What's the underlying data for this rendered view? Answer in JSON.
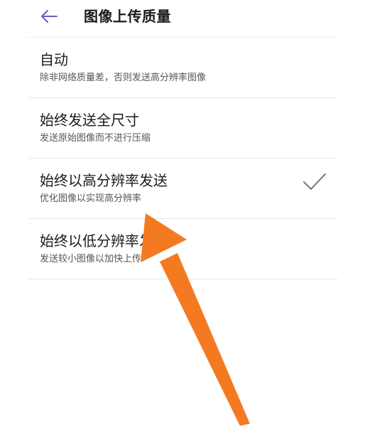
{
  "header": {
    "title": "图像上传质量",
    "back_icon": "arrow-left-icon"
  },
  "options": [
    {
      "title": "自动",
      "subtitle": "除非网络质量差，否则发送高分辨率图像",
      "selected": false
    },
    {
      "title": "始终发送全尺寸",
      "subtitle": "发送原始图像而不进行压缩",
      "selected": false
    },
    {
      "title": "始终以高分辨率发送",
      "subtitle": "优化图像以实现高分辨率",
      "selected": true
    },
    {
      "title": "始终以低分辨率发送",
      "subtitle": "发送较小图像以加快上传",
      "selected": false
    }
  ],
  "colors": {
    "accent": "#6b5fb5",
    "check": "#6a6a6a",
    "annotation_arrow": "#f47a22"
  }
}
